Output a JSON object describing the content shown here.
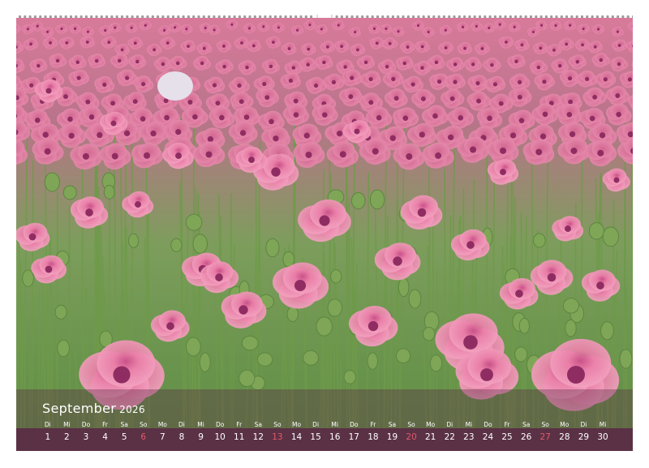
{
  "calendar": {
    "month": "September",
    "year": "2026",
    "weekdays": [
      "Di",
      "Mi",
      "Do",
      "Fr",
      "Sa",
      "So",
      "Mo",
      "Di",
      "Mi",
      "Do",
      "Fr",
      "Sa",
      "So",
      "Mo",
      "Di",
      "Mi",
      "Do",
      "Fr",
      "Sa",
      "So",
      "Mo",
      "Di",
      "Mi",
      "Do",
      "Fr",
      "Sa",
      "So",
      "Mo",
      "Di",
      "Mi"
    ],
    "days": [
      "1",
      "2",
      "3",
      "4",
      "5",
      "6",
      "7",
      "8",
      "9",
      "10",
      "11",
      "12",
      "13",
      "14",
      "15",
      "16",
      "17",
      "18",
      "19",
      "20",
      "21",
      "22",
      "23",
      "24",
      "25",
      "26",
      "27",
      "28",
      "29",
      "30"
    ],
    "sunday_color": "#e35a6a",
    "bar_color": "#5a3145"
  },
  "photo": {
    "subject": "field of pink poppy flowers",
    "flower_color": "#e9799f",
    "foliage_color": "#6f9a4a"
  }
}
